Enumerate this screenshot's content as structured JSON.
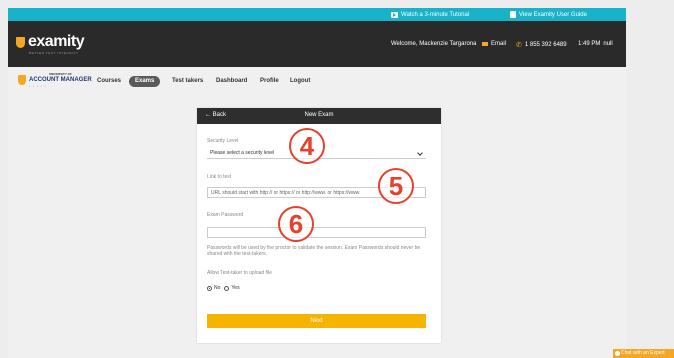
{
  "topbar": {
    "watch_tutorial": "Watch a 3-minute Tutorial",
    "user_guide": "View Examity User Guide"
  },
  "header": {
    "logo": "examity",
    "logo_sub": "BETTER TEST INTEGRITY",
    "welcome": "Welcome, Mackenzie Targarona",
    "email_label": "Email",
    "phone": "1 855 392 6489",
    "time": "1:49 PM",
    "time_suffix": "null"
  },
  "nav": {
    "uni_line1": "UNIVERSITY OF",
    "uni_line2": "ACCOUNT MANAGER",
    "uni_line3": "• • • • •",
    "items": [
      {
        "label": "Courses"
      },
      {
        "label": "Exams",
        "active": true
      },
      {
        "label": "Test takers"
      },
      {
        "label": "Dashboard"
      },
      {
        "label": "Profile"
      },
      {
        "label": "Logout"
      }
    ]
  },
  "form": {
    "back": "← Back",
    "title": "New Exam",
    "security_label": "Security Level",
    "security_value": "Please select a security level",
    "link_label": "Link to test",
    "link_placeholder": "URL should start with http:// or https:// or http://www. or https://www.",
    "password_label": "Exam Password",
    "password_value": "",
    "password_help": "Passwords will be used by the proctor to validate the session. Exam Passwords should never be shared with the test-takers.",
    "upload_label": "Allow Test-taker to upload file",
    "no_label": "No",
    "yes_label": "Yes",
    "upload_selected": "No",
    "next_label": "Next"
  },
  "annotations": {
    "n4": "4",
    "n5": "5",
    "n6": "6"
  },
  "chat": {
    "label": "Chat with an Expert"
  }
}
